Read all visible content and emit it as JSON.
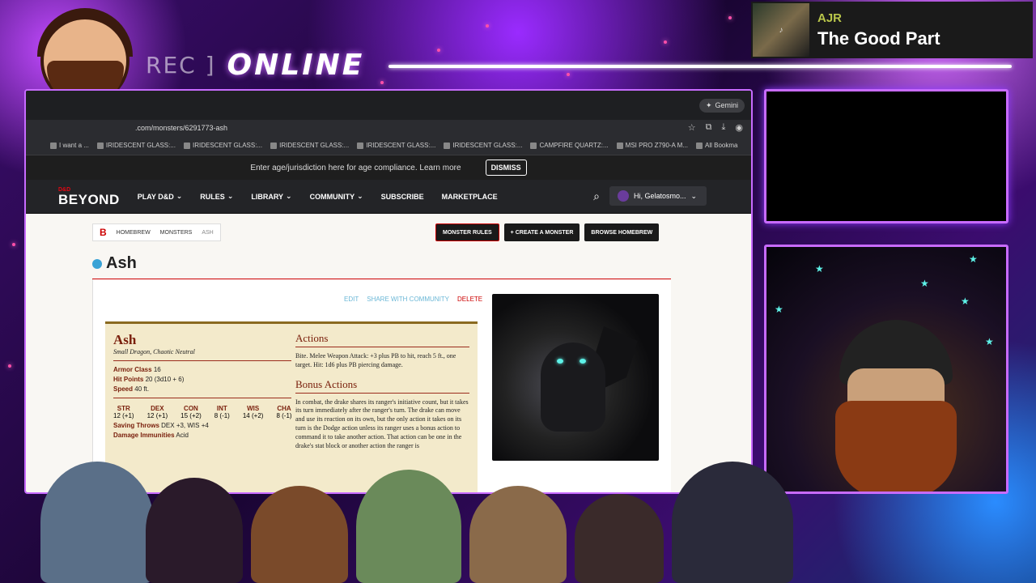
{
  "overlay": {
    "rec_label": "REC ]",
    "online_label": "ONLINE"
  },
  "now_playing": {
    "artist": "AJR",
    "song": "The Good Part"
  },
  "browser": {
    "gemini_label": "Gemini",
    "url": ".com/monsters/6291773-ash",
    "bookmarks": [
      "I want a ...",
      "IRIDESCENT GLASS:...",
      "IRIDESCENT GLASS:...",
      "IRIDESCENT GLASS:...",
      "IRIDESCENT GLASS:...",
      "IRIDESCENT GLASS:...",
      "CAMPFIRE QUARTZ:...",
      "MSI PRO Z790-A M...",
      "All Bookma"
    ]
  },
  "age_bar": {
    "text": "Enter age/jurisdiction here for age compliance. Learn more",
    "dismiss_label": "DISMISS"
  },
  "nav": {
    "logo_top": "D&D",
    "logo": "BEYOND",
    "items": [
      "PLAY D&D",
      "RULES",
      "LIBRARY",
      "COMMUNITY",
      "SUBSCRIBE",
      "MARKETPLACE"
    ],
    "user_label": "Hi, Gelatosmo..."
  },
  "breadcrumb": {
    "logo": "B",
    "items": [
      "HOMEBREW",
      "MONSTERS",
      "ASH"
    ]
  },
  "actions": {
    "monster_rules": "MONSTER RULES",
    "create_monster": "+ CREATE A MONSTER",
    "browse_homebrew": "BROWSE HOMEBREW"
  },
  "page_title": "Ash",
  "edit_links": {
    "edit": "EDIT",
    "share": "SHARE WITH COMMUNITY",
    "delete": "DELETE"
  },
  "statblock": {
    "name": "Ash",
    "type": "Small Dragon, Chaotic Neutral",
    "armor_class": "16",
    "hit_points": "20 (3d10 + 6)",
    "speed": "40 ft.",
    "abilities": [
      {
        "label": "STR",
        "value": "12 (+1)"
      },
      {
        "label": "DEX",
        "value": "12 (+1)"
      },
      {
        "label": "CON",
        "value": "15 (+2)"
      },
      {
        "label": "INT",
        "value": "8 (-1)"
      },
      {
        "label": "WIS",
        "value": "14 (+2)"
      },
      {
        "label": "CHA",
        "value": "8 (-1)"
      }
    ],
    "saves": "DEX +3, WIS +4",
    "immunities": "Acid",
    "actions_heading": "Actions",
    "bite": "Bite. Melee Weapon Attack: +3 plus PB to hit, reach 5 ft., one target. Hit: 1d6 plus PB piercing damage.",
    "bonus_heading": "Bonus Actions",
    "bonus_text": "In combat, the drake shares its ranger's initiative count, but it takes its turn immediately after the ranger's turn. The drake can move and use its reaction on its own, but the only action it takes on its turn is the Dodge action unless its ranger uses a bonus action to command it to take another action. That action can be one in the drake's stat block or another action the ranger is"
  },
  "labels": {
    "armor_class": "Armor Class",
    "hit_points": "Hit Points",
    "speed": "Speed",
    "saves": "Saving Throws",
    "immunities": "Damage Immunities"
  }
}
